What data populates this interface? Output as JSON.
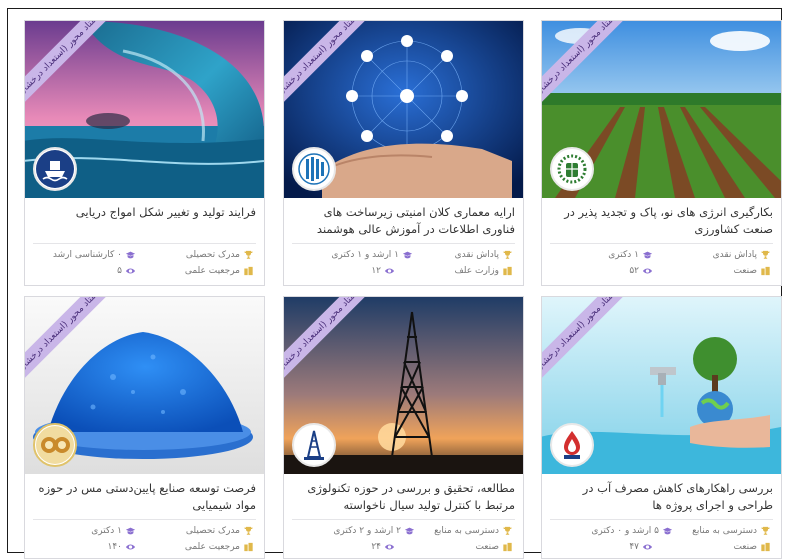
{
  "ribbon_text": "استاد محور (استعداد درخشان)",
  "cards": [
    {
      "title": "فرایند تولید و تغییر شکل امواج دریایی",
      "meta1_label": "مدرک تحصیلی",
      "meta1_value": "۰ کارشناسی ارشد",
      "meta2_label": "مرجعیت علمی",
      "meta2_value": "۵"
    },
    {
      "title": "ارایه معماری کلان امنیتی زیرساخت های فناوری اطلاعات در آموزش عالی هوشمند",
      "meta1_label": "پاداش نقدی",
      "meta1_value": "۱ ارشد و ۱ دکتری",
      "meta2_label": "وزارت علف",
      "meta2_value": "۱۲"
    },
    {
      "title": "بکارگیری انرژی های نو، پاک و تجدید پذیر در صنعت کشاورزی",
      "meta1_label": "پاداش نقدی",
      "meta1_value": "۱ دکتری",
      "meta2_label": "صنعت",
      "meta2_value": "۵۲"
    },
    {
      "title": "فرصت توسعه صنایع پایین‌دستی مس در حوزه مواد شیمیایی",
      "meta1_label": "مدرک تحصیلی",
      "meta1_value": "۱ دکتری",
      "meta2_label": "مرجعیت علمی",
      "meta2_value": "۱۴۰"
    },
    {
      "title": "مطالعه، تحقیق و بررسی در حوزه تکنولوژی مرتبط با کنترل تولید سیال ناخواسته",
      "meta1_label": "دسترسی به منابع",
      "meta1_value": "۲ ارشد و ۲ دکتری",
      "meta2_label": "صنعت",
      "meta2_value": "۲۴"
    },
    {
      "title": "بررسی راهکارهای کاهش مصرف آب در طراحی و اجرای پروژه ها",
      "meta1_label": "دسترسی به منابع",
      "meta1_value": "۵ ارشد و ۰ دکتری",
      "meta2_label": "صنعت",
      "meta2_value": "۴۷"
    }
  ]
}
